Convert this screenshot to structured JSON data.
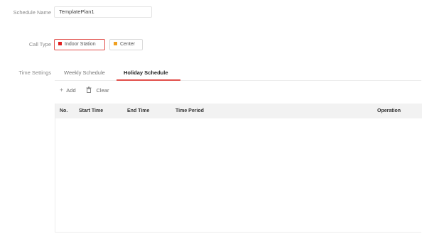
{
  "form": {
    "schedule_name_label": "Schedule Name",
    "schedule_name_value": "TemplatePlan1",
    "call_type_label": "Call Type",
    "call_type_options": [
      {
        "label": "Indoor Station",
        "color": "#e02020",
        "selected": true
      },
      {
        "label": "Center",
        "color": "#f0a020",
        "selected": false
      }
    ],
    "time_settings_label": "Time Settings"
  },
  "tabs": [
    {
      "label": "Weekly Schedule",
      "active": false
    },
    {
      "label": "Holiday Schedule",
      "active": true
    }
  ],
  "toolbar": {
    "add_label": "Add",
    "add_icon": "plus-icon",
    "clear_label": "Clear",
    "clear_icon": "trash-icon"
  },
  "table": {
    "columns": [
      "No.",
      "Start Time",
      "End Time",
      "Time Period",
      "Operation"
    ],
    "rows": []
  },
  "colors": {
    "accent": "#e2504c",
    "header_bg": "#f2f2f2"
  }
}
